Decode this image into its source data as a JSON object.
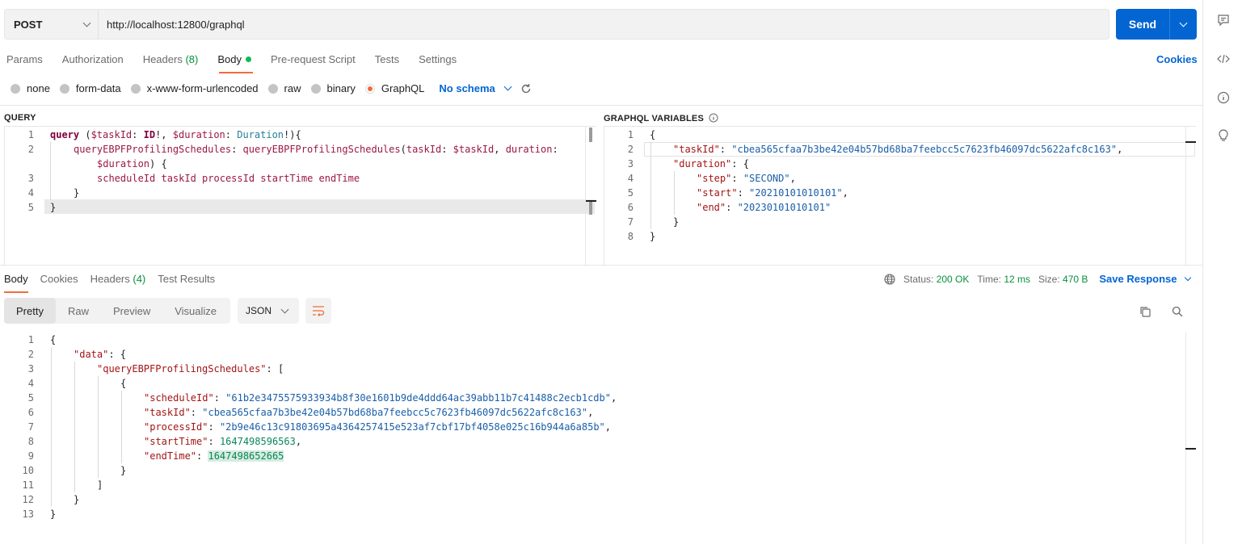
{
  "request": {
    "method": "POST",
    "url": "http://localhost:12800/graphql",
    "send_label": "Send"
  },
  "req_tabs": {
    "params": "Params",
    "authorization": "Authorization",
    "headers": "Headers",
    "headers_count": "(8)",
    "body": "Body",
    "prerequest": "Pre-request Script",
    "tests": "Tests",
    "settings": "Settings",
    "cookies": "Cookies"
  },
  "body_types": {
    "none": "none",
    "form_data": "form-data",
    "urlencoded": "x-www-form-urlencoded",
    "raw": "raw",
    "binary": "binary",
    "graphql": "GraphQL",
    "selected": "GraphQL",
    "schema": "No schema"
  },
  "query_panel": {
    "title": "QUERY",
    "line_numbers": [
      "1",
      "2",
      "",
      "3",
      "4",
      "5"
    ],
    "l1": {
      "kw": "query",
      "a": " (",
      "v1": "$taskId",
      "b": ": ",
      "t1": "ID",
      "c": "!, ",
      "v2": "$duration",
      "d": ": ",
      "t2": "Duration",
      "e": "!){"
    },
    "l2": {
      "alias": "queryEBPFProfilingSchedules",
      "a": ": ",
      "fn": "queryEBPFProfilingSchedules",
      "b": "(",
      "arg1": "taskId",
      "c": ": ",
      "v1": "$taskId",
      "d": ", ",
      "arg2": "duration",
      "e": ":"
    },
    "l2b": {
      "v2": "$duration",
      "a": ") {"
    },
    "l3": "scheduleId taskId processId startTime endTime",
    "l4": "}",
    "l5": "}"
  },
  "variables_panel": {
    "title": "GRAPHQL VARIABLES",
    "line_numbers": [
      "1",
      "2",
      "3",
      "4",
      "5",
      "6",
      "7",
      "8"
    ],
    "open": "{",
    "taskId_key": "\"taskId\"",
    "taskId_val": "\"cbea565cfaa7b3be42e04b57bd68ba7feebcc5c7623fb46097dc5622afc8c163\"",
    "duration_key": "\"duration\"",
    "step_key": "\"step\"",
    "step_val": "\"SECOND\"",
    "start_key": "\"start\"",
    "start_val": "\"20210101010101\"",
    "end_key": "\"end\"",
    "end_val": "\"20230101010101\"",
    "close_inner": "}",
    "close": "}"
  },
  "response": {
    "tabs": {
      "body": "Body",
      "cookies": "Cookies",
      "headers": "Headers",
      "headers_count": "(4)",
      "test_results": "Test Results"
    },
    "status_label": "Status:",
    "status_value": "200 OK",
    "time_label": "Time:",
    "time_value": "12 ms",
    "size_label": "Size:",
    "size_value": "470 B",
    "save_label": "Save Response",
    "views": [
      "Pretty",
      "Raw",
      "Preview",
      "Visualize"
    ],
    "active_view": "Pretty",
    "format": "JSON",
    "line_numbers": [
      "1",
      "2",
      "3",
      "4",
      "5",
      "6",
      "7",
      "8",
      "9",
      "10",
      "11",
      "12",
      "13"
    ],
    "json": {
      "open": "{",
      "data_key": "\"data\"",
      "list_key": "\"queryEBPFProfilingSchedules\"",
      "scheduleId_key": "\"scheduleId\"",
      "scheduleId_val": "\"61b2e3475575933934b8f30e1601b9de4ddd64ac39abb11b7c41488c2ecb1cdb\"",
      "taskId_key": "\"taskId\"",
      "taskId_val": "\"cbea565cfaa7b3be42e04b57bd68ba7feebcc5c7623fb46097dc5622afc8c163\"",
      "processId_key": "\"processId\"",
      "processId_val": "\"2b9e46c13c91803695a4364257415e523af7cbf17bf4058e025c16b944a6a85b\"",
      "startTime_key": "\"startTime\"",
      "startTime_val": "1647498596563",
      "endTime_key": "\"endTime\"",
      "endTime_val": "1647498652665"
    }
  },
  "icons": {
    "rail": [
      "comment-icon",
      "code-icon",
      "info-icon",
      "lightbulb-icon"
    ],
    "status": "globe-icon",
    "actions": [
      "copy-icon",
      "search-icon"
    ]
  },
  "colors": {
    "accent": "#0265d2",
    "active_tab_underline": "#f26b3a",
    "status_ok": "#0a8f3a"
  }
}
